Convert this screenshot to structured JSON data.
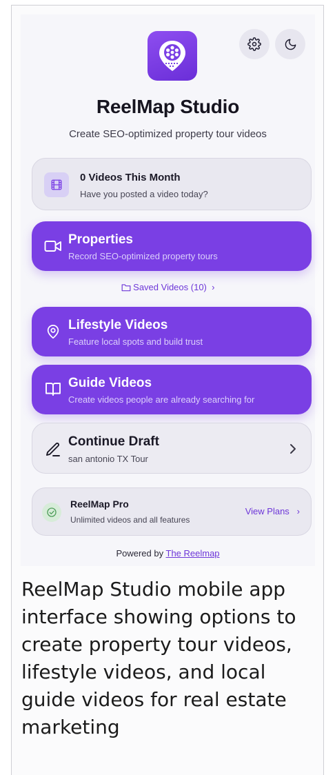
{
  "app": {
    "title": "ReelMap Studio",
    "subtitle": "Create SEO-optimized property tour videos"
  },
  "header": {
    "settings_icon": "gear-icon",
    "theme_icon": "moon-icon",
    "logo_icon": "film-reel-map-pin-icon"
  },
  "stats": {
    "title": "0 Videos This Month",
    "subtitle": "Have you posted a video today?",
    "icon": "film-icon"
  },
  "actions": {
    "properties": {
      "title": "Properties",
      "subtitle": "Record SEO-optimized property tours",
      "icon": "video-camera-icon"
    },
    "saved_videos": "Saved Videos (10)",
    "lifestyle": {
      "title": "Lifestyle Videos",
      "subtitle": "Feature local spots and build trust",
      "icon": "map-pin-icon"
    },
    "guide": {
      "title": "Guide Videos",
      "subtitle": "Create videos people are already searching for",
      "icon": "book-icon"
    }
  },
  "draft": {
    "title": "Continue Draft",
    "subtitle": "san antonio TX Tour",
    "icon": "pencil-icon"
  },
  "pro": {
    "title": "ReelMap Pro",
    "subtitle": "Unlimited videos and all features",
    "link": "View Plans",
    "icon": "check-circle-icon"
  },
  "footer": {
    "prefix": "Powered by",
    "link": "The Reelmap"
  },
  "caption": "ReelMap Studio mobile app interface showing options to create property tour videos, lifestyle videos, and local guide videos for real estate marketing",
  "colors": {
    "accent": "#7a3fe4",
    "link": "#6d36d8",
    "background": "#f6f6fa"
  }
}
